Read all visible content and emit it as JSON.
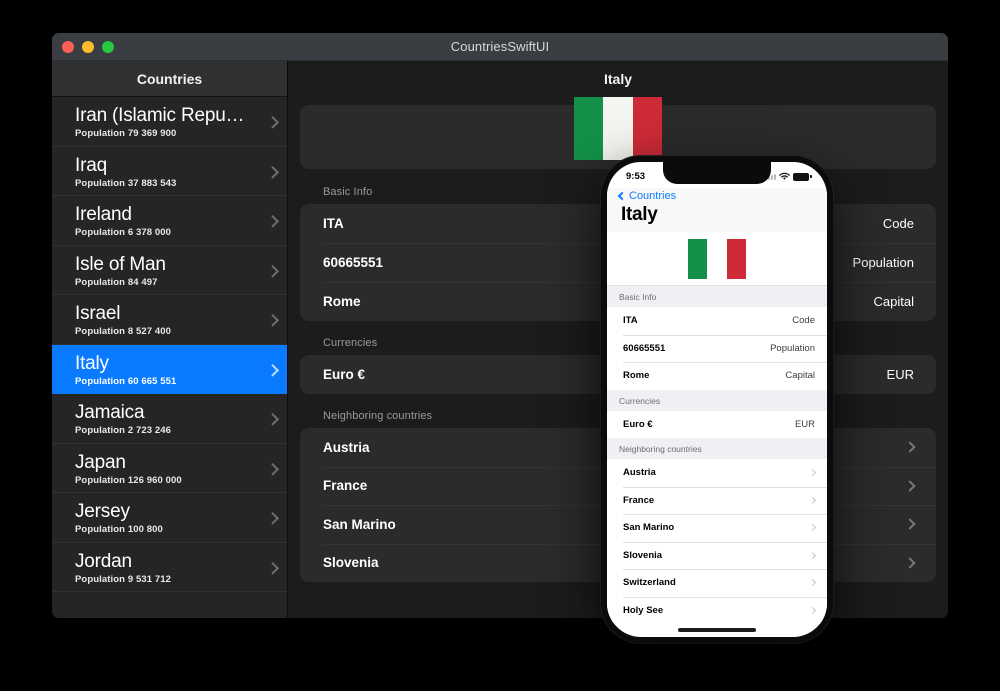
{
  "window": {
    "title": "CountriesSwiftUI",
    "traffic_lights": [
      "close-button",
      "minimize-button",
      "maximize-button"
    ]
  },
  "sidebar": {
    "header": "Countries",
    "items": [
      {
        "name": "Iran (Islamic Repu…",
        "population": "Population 79 369 900",
        "selected": false
      },
      {
        "name": "Iraq",
        "population": "Population 37 883 543",
        "selected": false
      },
      {
        "name": "Ireland",
        "population": "Population 6 378 000",
        "selected": false
      },
      {
        "name": "Isle of Man",
        "population": "Population 84 497",
        "selected": false
      },
      {
        "name": "Israel",
        "population": "Population 8 527 400",
        "selected": false
      },
      {
        "name": "Italy",
        "population": "Population 60 665 551",
        "selected": true
      },
      {
        "name": "Jamaica",
        "population": "Population 2 723 246",
        "selected": false
      },
      {
        "name": "Japan",
        "population": "Population 126 960 000",
        "selected": false
      },
      {
        "name": "Jersey",
        "population": "Population 100 800",
        "selected": false
      },
      {
        "name": "Jordan",
        "population": "Population 9 531 712",
        "selected": false
      }
    ]
  },
  "detail": {
    "header": "Italy",
    "flag": {
      "colors": [
        "#139148",
        "#f4f5f0",
        "#cd2b37"
      ],
      "name": "italy-flag"
    },
    "sections": {
      "basic_info": {
        "label": "Basic Info",
        "rows": [
          {
            "value": "ITA",
            "key": "Code"
          },
          {
            "value": "60665551",
            "key": "Population"
          },
          {
            "value": "Rome",
            "key": "Capital"
          }
        ]
      },
      "currencies": {
        "label": "Currencies",
        "rows": [
          {
            "value": "Euro €",
            "key": "EUR"
          }
        ]
      },
      "neighbors": {
        "label": "Neighboring countries",
        "rows": [
          {
            "value": "Austria"
          },
          {
            "value": "France"
          },
          {
            "value": "San Marino"
          },
          {
            "value": "Slovenia"
          }
        ]
      }
    }
  },
  "phone": {
    "status": {
      "time": "9:53",
      "wifi": "wifi-icon",
      "battery": "battery-icon"
    },
    "back_label": "Countries",
    "title": "Italy",
    "flag": {
      "colors": [
        "#139148",
        "#ffffff",
        "#cd2b37"
      ]
    },
    "sections": {
      "basic_info": {
        "label": "Basic Info",
        "rows": [
          {
            "value": "ITA",
            "key": "Code"
          },
          {
            "value": "60665551",
            "key": "Population"
          },
          {
            "value": "Rome",
            "key": "Capital"
          }
        ]
      },
      "currencies": {
        "label": "Currencies",
        "rows": [
          {
            "value": "Euro €",
            "key": "EUR"
          }
        ]
      },
      "neighbors": {
        "label": "Neighboring countries",
        "rows": [
          {
            "value": "Austria"
          },
          {
            "value": "France"
          },
          {
            "value": "San Marino"
          },
          {
            "value": "Slovenia"
          },
          {
            "value": "Switzerland"
          },
          {
            "value": "Holy See"
          }
        ]
      }
    }
  },
  "colors": {
    "accent": "#0a7bff",
    "window_chrome": "#3a3e43",
    "sidebar_bg": "#252525",
    "detail_bg": "#1c1c1c",
    "card_bg": "#2b2b2b"
  }
}
